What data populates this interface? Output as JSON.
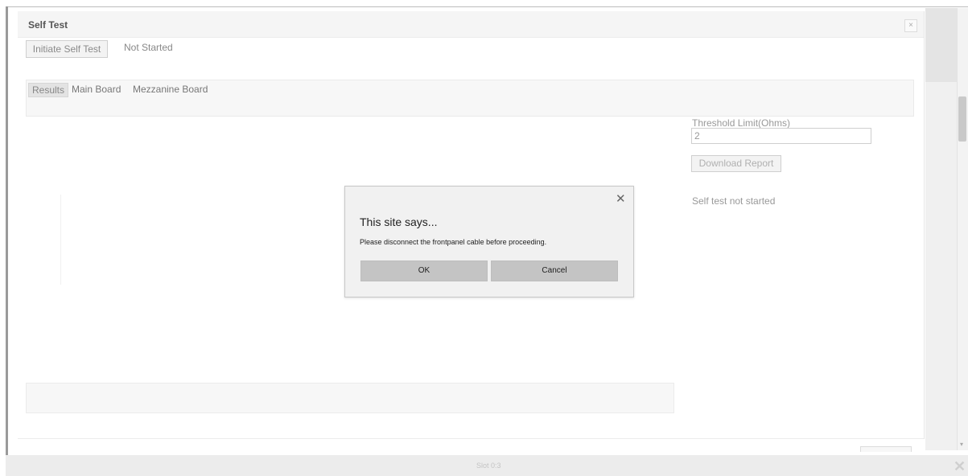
{
  "modal": {
    "title": "Self Test",
    "close_glyph": "×",
    "initiate_label": "Initiate Self Test",
    "status": "Not Started",
    "tabs": [
      "Results",
      "Main Board",
      "Mezzanine Board"
    ],
    "threshold_label": "Threshold Limit(Ohms)",
    "threshold_value": "2",
    "download_label": "Download Report",
    "selftest_status": "Self test not started"
  },
  "footer": {
    "slot": "Slot 0:3",
    "close_glyph": "✕"
  },
  "dialog": {
    "close_glyph": "✕",
    "title": "This site says...",
    "message": "Please disconnect the frontpanel cable before proceeding.",
    "ok_label": "OK",
    "cancel_label": "Cancel"
  },
  "scrollbar": {
    "down_arrow": "▾"
  }
}
